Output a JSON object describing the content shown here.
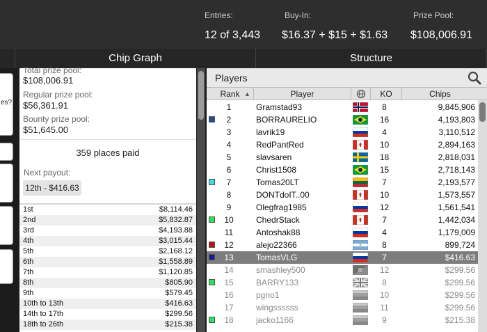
{
  "header": {
    "entries_label": "Entries:",
    "entries_value": "12 of 3,443",
    "buyin_label": "Buy-In:",
    "buyin_value": "$16.37 + $15 + $1.63",
    "prizepool_label": "Prize Pool:",
    "prizepool_value": "$108,006.91"
  },
  "tabs": {
    "chip_graph": "Chip Graph",
    "structure": "Structure"
  },
  "left_stub": {
    "partial_text": "es?"
  },
  "prize_info": {
    "total_label": "Total prize pool:",
    "total_value": "$108,006.91",
    "regular_label": "Regular prize pool:",
    "regular_value": "$56,361.91",
    "bounty_label": "Bounty prize pool:",
    "bounty_value": "$51,645.00",
    "places_paid": "359 places paid",
    "next_payout_label": "Next payout:",
    "next_payout_value": "12th - $416.63"
  },
  "payouts": [
    {
      "place": "1st",
      "amount": "$8,114.46"
    },
    {
      "place": "2nd",
      "amount": "$5,832.87"
    },
    {
      "place": "3rd",
      "amount": "$4,193.88"
    },
    {
      "place": "4th",
      "amount": "$3,015.44"
    },
    {
      "place": "5th",
      "amount": "$2,168.12"
    },
    {
      "place": "6th",
      "amount": "$1,558.89"
    },
    {
      "place": "7th",
      "amount": "$1,120.85"
    },
    {
      "place": "8th",
      "amount": "$805.90"
    },
    {
      "place": "9th",
      "amount": "$579.45"
    },
    {
      "place": "10th to 13th",
      "amount": "$416.63"
    },
    {
      "place": "14th to 17th",
      "amount": "$299.56"
    },
    {
      "place": "18th to 26th",
      "amount": "$215.38"
    }
  ],
  "players_panel": {
    "title": "Players",
    "search_icon": "magnifier-icon",
    "columns": {
      "rank": "Rank",
      "player": "Player",
      "country_icon": "globe-icon",
      "ko": "KO",
      "chips": "Chips"
    }
  },
  "players": [
    {
      "rank": "1",
      "name": "Gramstad93",
      "flag": "norway",
      "ko": "8",
      "chips": "9,845,906",
      "marker": ""
    },
    {
      "rank": "2",
      "name": "BORRAURELIO",
      "flag": "brazil",
      "ko": "16",
      "chips": "4,193,803",
      "marker": "#1f4e8c"
    },
    {
      "rank": "3",
      "name": "lavrik19",
      "flag": "russia",
      "ko": "4",
      "chips": "3,110,512",
      "marker": ""
    },
    {
      "rank": "4",
      "name": "RedPantRed",
      "flag": "canada",
      "ko": "10",
      "chips": "2,894,163",
      "marker": ""
    },
    {
      "rank": "5",
      "name": "slavsaren",
      "flag": "sweden",
      "ko": "18",
      "chips": "2,818,031",
      "marker": ""
    },
    {
      "rank": "6",
      "name": "Christ1508",
      "flag": "brazil",
      "ko": "15",
      "chips": "2,718,143",
      "marker": ""
    },
    {
      "rank": "7",
      "name": "Tomas20LT",
      "flag": "lithuania",
      "ko": "7",
      "chips": "2,193,577",
      "marker": "#3fd9e8"
    },
    {
      "rank": "8",
      "name": "DONTdoIT..00",
      "flag": "canada",
      "ko": "10",
      "chips": "1,573,557",
      "marker": ""
    },
    {
      "rank": "9",
      "name": "Olegfrag1985",
      "flag": "russia",
      "ko": "12",
      "chips": "1,561,541",
      "marker": ""
    },
    {
      "rank": "10",
      "name": "ChedrStack",
      "flag": "canada",
      "ko": "7",
      "chips": "1,442,034",
      "marker": "#2ee05a"
    },
    {
      "rank": "11",
      "name": "Antoshak88",
      "flag": "russia",
      "ko": "4",
      "chips": "1,179,009",
      "marker": ""
    },
    {
      "rank": "12",
      "name": "alejo22366",
      "flag": "argentina",
      "ko": "8",
      "chips": "899,724",
      "marker": "#b01818"
    },
    {
      "rank": "13",
      "name": "TomasVLG",
      "flag": "russia",
      "ko": "7",
      "chips": "$416.63",
      "marker": "#10208a",
      "selected": true
    },
    {
      "rank": "14",
      "name": "smashley500",
      "flag": "unknown",
      "ko": "12",
      "chips": "$299.56",
      "marker": "",
      "eliminated": true
    },
    {
      "rank": "15",
      "name": "BARRY133",
      "flag": "uk",
      "ko": "8",
      "chips": "$299.56",
      "marker": "#2ee05a",
      "eliminated": true
    },
    {
      "rank": "16",
      "name": "pgno1",
      "flag": "greyed",
      "ko": "10",
      "chips": "$299.56",
      "marker": "",
      "eliminated": true
    },
    {
      "rank": "17",
      "name": "wingssssss",
      "flag": "greyed",
      "ko": "11",
      "chips": "$299.56",
      "marker": "",
      "eliminated": true
    },
    {
      "rank": "18",
      "name": "jacko1166",
      "flag": "greyed",
      "ko": "9",
      "chips": "$215.38",
      "marker": "#2ee05a",
      "eliminated": true
    }
  ]
}
